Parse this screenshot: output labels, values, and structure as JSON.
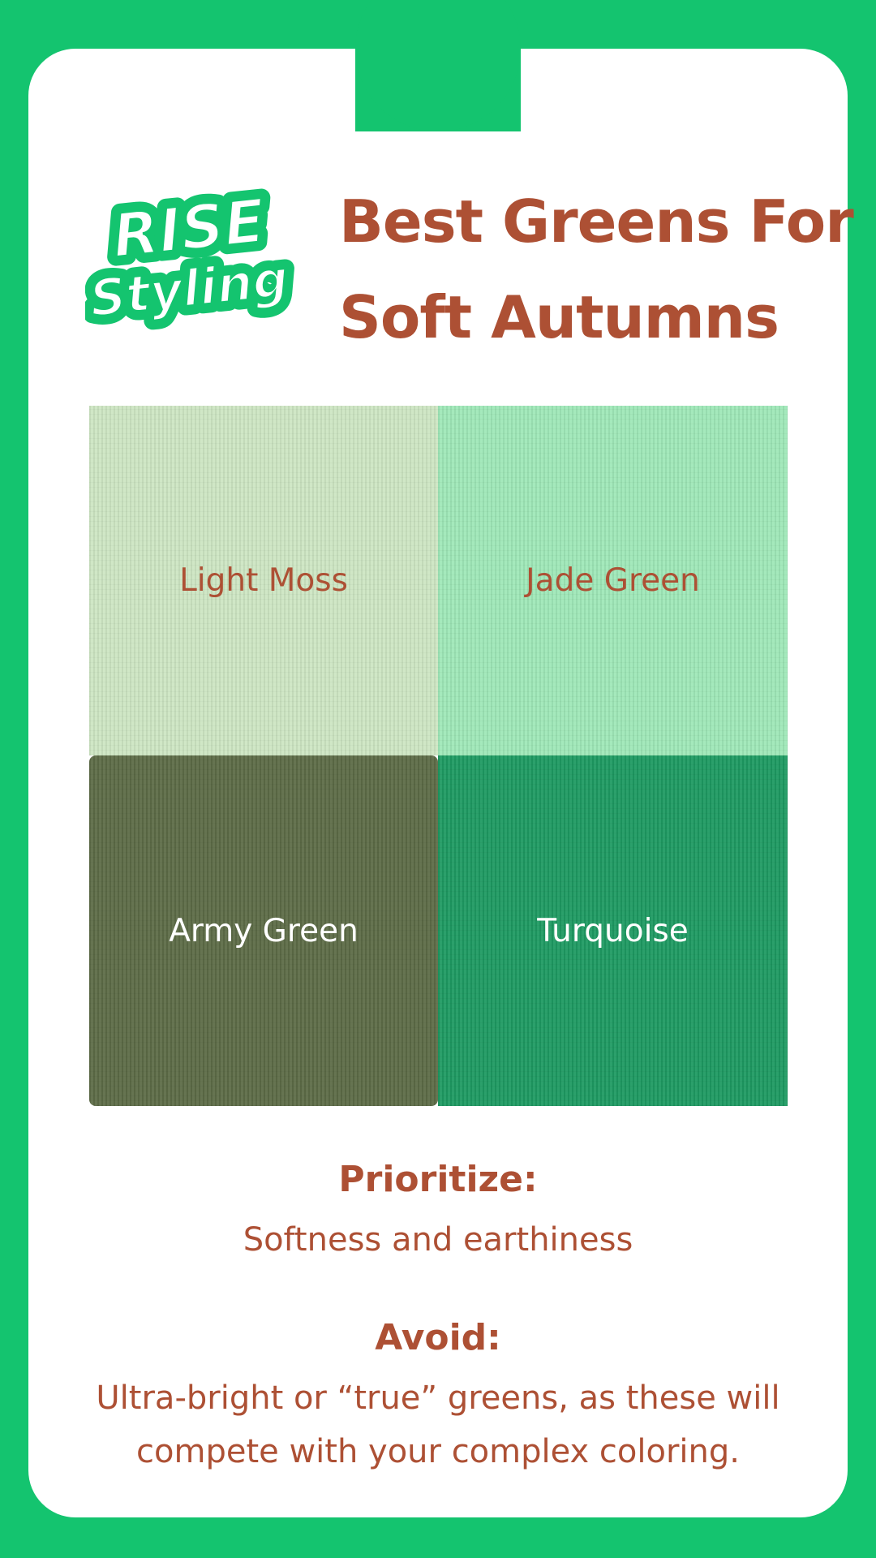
{
  "brand": {
    "logo_line1": "RISE",
    "logo_line2": "Styling"
  },
  "title": {
    "line1": "Best Greens For",
    "line2": "Soft Autumns"
  },
  "swatches": [
    {
      "label": "Light Moss",
      "color": "#cde6c3",
      "text_color": "#ad5034"
    },
    {
      "label": "Jade Green",
      "color": "#9fe8b8",
      "text_color": "#ad5034"
    },
    {
      "label": "Army Green",
      "color": "#5d6c47",
      "text_color": "#ffffff"
    },
    {
      "label": "Turquoise",
      "color": "#1e9a62",
      "text_color": "#ffffff"
    }
  ],
  "prioritize": {
    "label": "Prioritize:",
    "text": "Softness and earthiness"
  },
  "avoid": {
    "label": "Avoid:",
    "line1": "Ultra-bright or “true” greens, as these will",
    "line2": "compete with your complex coloring."
  },
  "colors": {
    "background": "#14c46f",
    "card": "#ffffff",
    "accent_text": "#ad5034"
  }
}
